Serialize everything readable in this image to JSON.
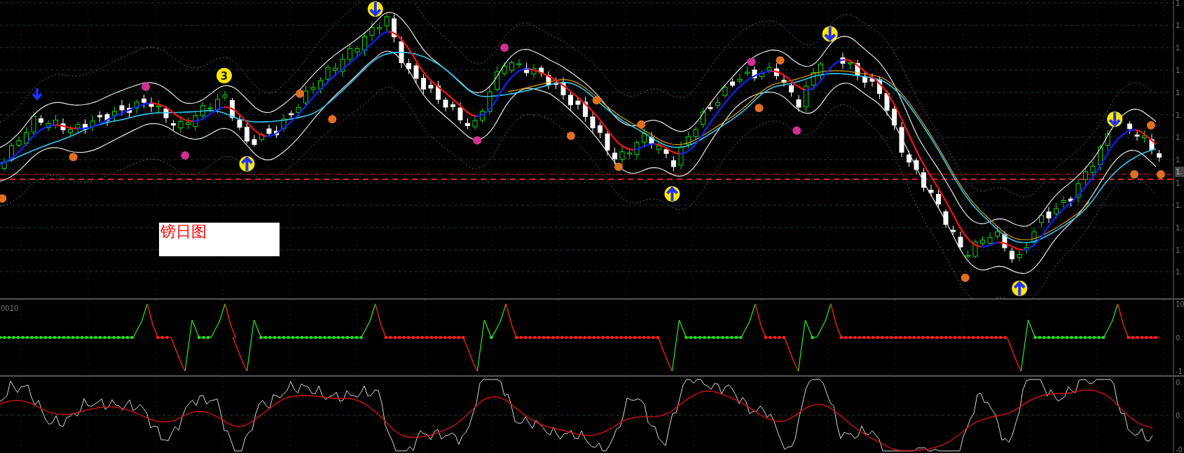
{
  "price_panel": {
    "chart_label": "镑日图",
    "signal_badge": "3",
    "axis_labels": [
      "1.",
      "1.",
      "1.",
      "1.",
      "1.",
      "1.",
      "1.",
      "1.",
      "1.",
      "1.",
      "1.",
      "1.",
      "1."
    ],
    "current_price": "1."
  },
  "oscillator_panel": {
    "title": "0010",
    "axis_labels": [
      "10",
      "0.",
      "-1"
    ]
  },
  "momentum_panel": {
    "axis_labels": [
      "0.",
      "0.",
      "-0"
    ]
  }
}
